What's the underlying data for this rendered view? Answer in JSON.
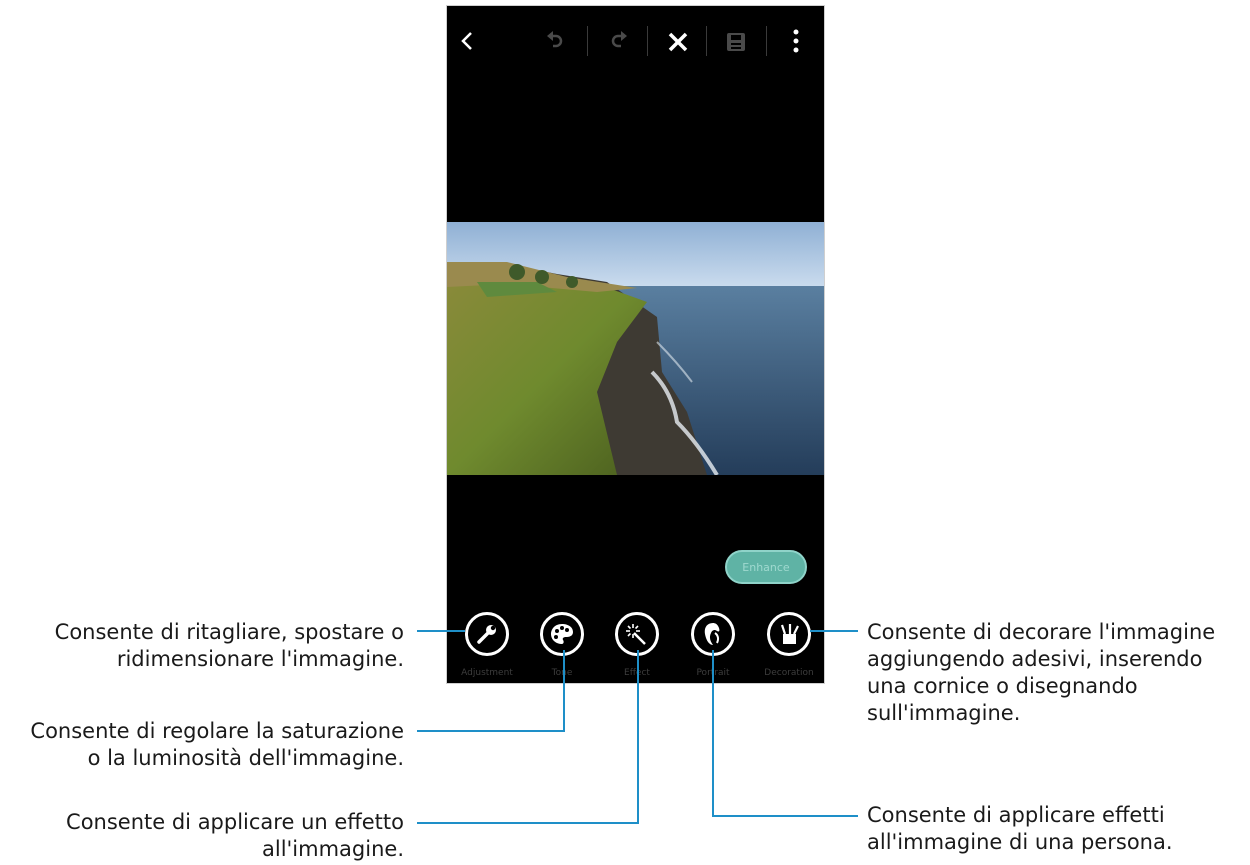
{
  "toolbar": {
    "icons": [
      "back-icon",
      "undo-icon",
      "redo-icon",
      "close-icon",
      "save-icon",
      "more-icon"
    ]
  },
  "enhance_label": "Enhance",
  "tools": [
    {
      "label": "Adjustment",
      "icon": "wrench-icon"
    },
    {
      "label": "Tone",
      "icon": "palette-icon"
    },
    {
      "label": "Effect",
      "icon": "magic-wand-icon"
    },
    {
      "label": "Portrait",
      "icon": "portrait-icon"
    },
    {
      "label": "Decoration",
      "icon": "decoration-icon"
    }
  ],
  "callouts": {
    "adjustment": [
      "Consente di ritagliare, spostare o",
      "ridimensionare l'immagine."
    ],
    "tone": [
      "Consente di regolare la saturazione",
      "o la luminosità dell'immagine."
    ],
    "effect": [
      "Consente di applicare un effetto",
      "all'immagine."
    ],
    "decoration": [
      "Consente di decorare l'immagine",
      "aggiungendo adesivi, inserendo",
      "una cornice o disegnando",
      "sull'immagine."
    ],
    "portrait": [
      "Consente di applicare effetti",
      "all'immagine di una persona."
    ]
  },
  "colors": {
    "callout_line": "#1e8fc8",
    "enhance_button": "#5fb3a5"
  }
}
